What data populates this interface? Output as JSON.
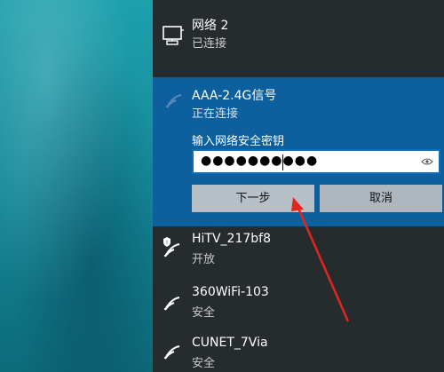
{
  "networks": {
    "wired": {
      "name": "网络 2",
      "status": "已连接"
    },
    "active": {
      "name": "AAA-2.4G信号",
      "status": "正在连接",
      "password_label": "输入网络安全密钥",
      "password_masked": "●●●●●●●●●●",
      "next_button": "下一步",
      "cancel_button": "取消"
    },
    "list": [
      {
        "name": "HiTV_217bf8",
        "status": "开放",
        "secured": false
      },
      {
        "name": "360WiFi-103",
        "status": "安全",
        "secured": true
      },
      {
        "name": "CUNET_7Via",
        "status": "安全",
        "secured": true
      }
    ]
  },
  "colors": {
    "panel": "#262b2e",
    "active_bg": "#0e5f9e",
    "button": "#b7c0c6",
    "annotation_arrow": "#e1261c"
  }
}
